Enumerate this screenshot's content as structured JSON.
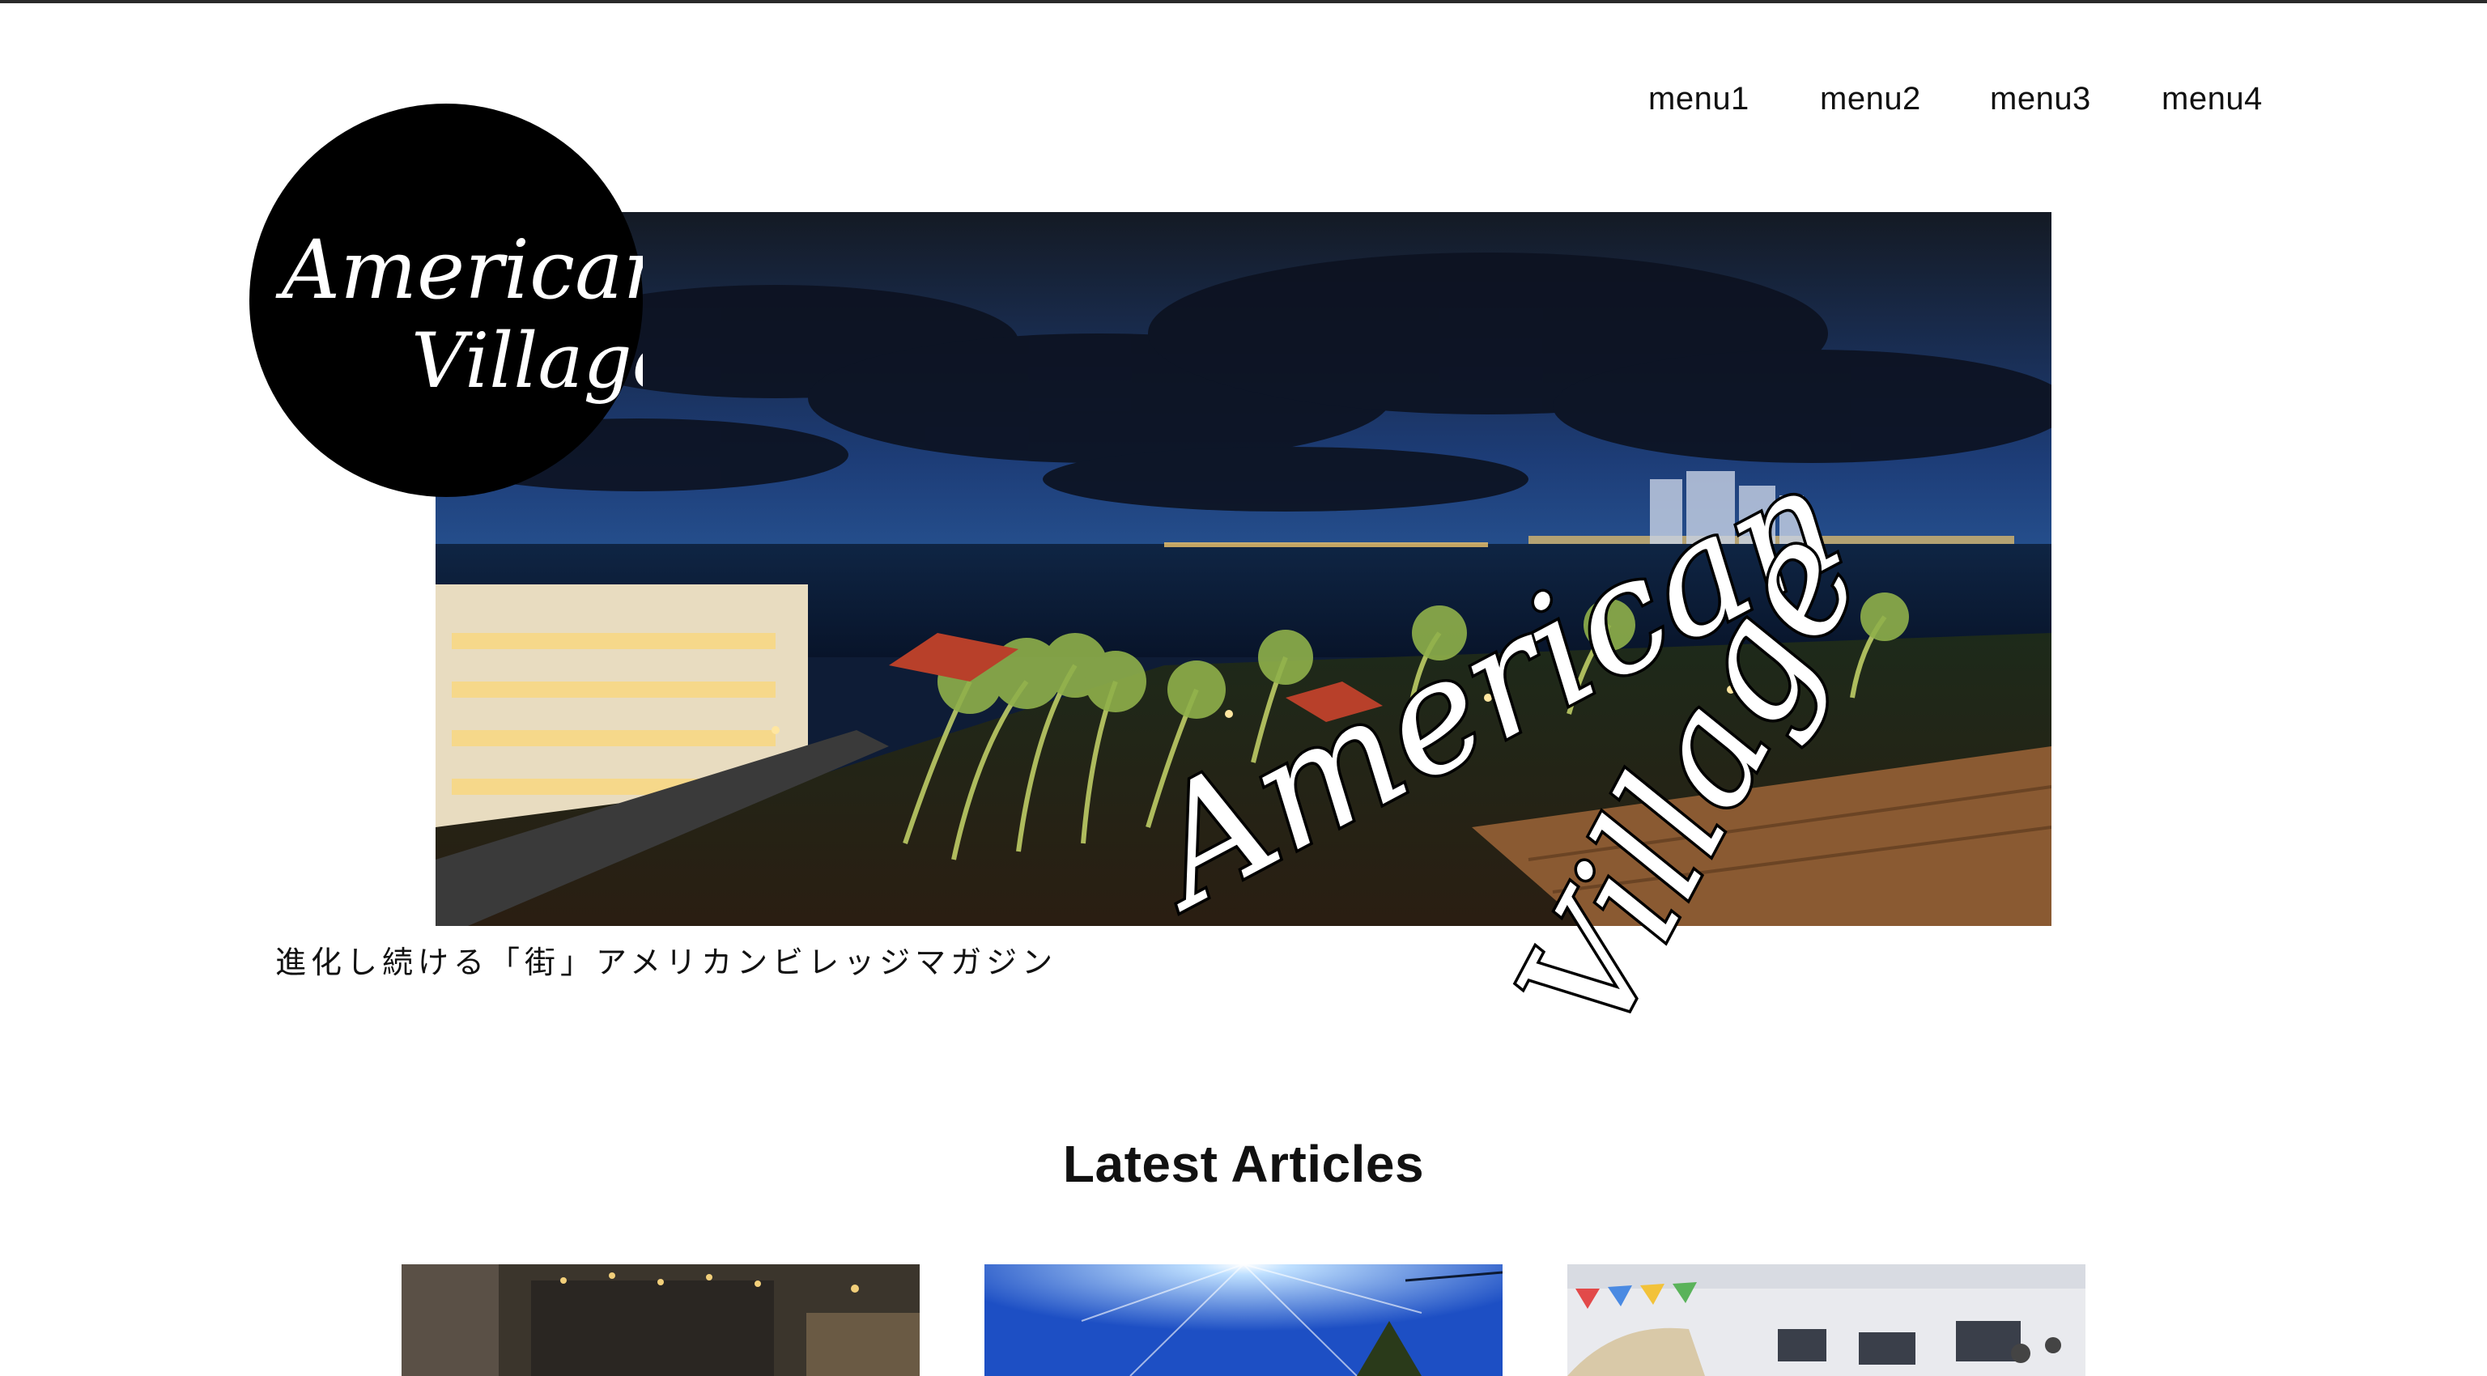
{
  "nav": {
    "items": [
      "menu1",
      "menu2",
      "menu3",
      "menu4"
    ]
  },
  "logo": {
    "text": "American Village",
    "line1": "American",
    "line2": "Village"
  },
  "hero": {
    "overlay_line1": "American",
    "overlay_line2": "Village"
  },
  "tagline": "進化し続ける「街」アメリカンビレッジマガジン",
  "latest": {
    "title": "Latest Articles"
  },
  "colors": {
    "text": "#111111",
    "logo_bg": "#000000",
    "night_sky": "#0b1a3a"
  }
}
